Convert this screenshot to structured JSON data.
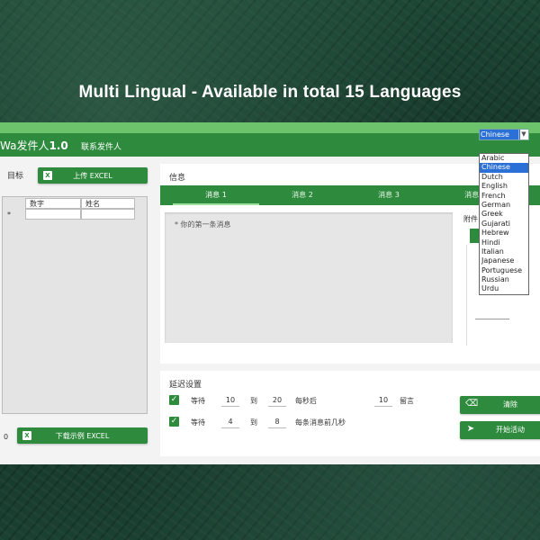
{
  "headline": "Multi Lingual - Available in total 15 Languages",
  "app": {
    "title_prefix": "Wa发件人",
    "title_version": "1.0",
    "subtitle": "联系发件人",
    "language_select": {
      "value": "Chinese",
      "options": [
        "Arabic",
        "Chinese",
        "Dutch",
        "English",
        "French",
        "German",
        "Greek",
        "Gujarati",
        "Hebrew",
        "Hindi",
        "Italian",
        "Japanese",
        "Portuguese",
        "Russian",
        "Urdu"
      ],
      "selected_index": 1
    }
  },
  "left": {
    "target_label": "目标",
    "upload_button": "上传 EXCEL",
    "columns": [
      "数字",
      "姓名"
    ],
    "new_row_marker": "*",
    "count": "0",
    "download_button": "下载示例 EXCEL",
    "excel_icon": "X"
  },
  "message": {
    "title": "信息",
    "tabs": [
      "消息 1",
      "消息 2",
      "消息 3",
      "消息 4"
    ],
    "placeholder": "* 你的第一条消息",
    "attachment_label": "附件"
  },
  "delay": {
    "title": "延迟设置",
    "row1": {
      "wait": "等待",
      "from": "10",
      "to_label": "到",
      "to": "20",
      "after": "每秒后",
      "count": "10",
      "suffix": "留言"
    },
    "row2": {
      "wait": "等待",
      "from": "4",
      "to_label": "到",
      "to": "8",
      "after": "每条消息前几秒"
    }
  },
  "actions": {
    "clear": "清除",
    "start": "开始活动"
  },
  "colors": {
    "primary": "#2e8b3e",
    "accent": "#6cc36c",
    "select_highlight": "#2b70d6"
  }
}
